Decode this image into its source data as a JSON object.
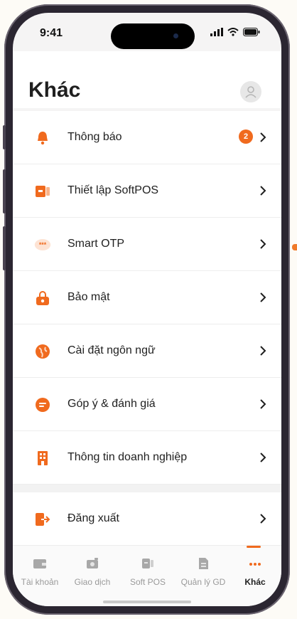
{
  "status_bar": {
    "time": "9:41"
  },
  "header": {
    "title": "Khác"
  },
  "menu": [
    {
      "label": "Thông báo",
      "icon": "bell-icon",
      "badge": "2"
    },
    {
      "label": "Thiết lập SoftPOS",
      "icon": "softpos-icon"
    },
    {
      "label": "Smart OTP",
      "icon": "otp-icon"
    },
    {
      "label": "Bảo mật",
      "icon": "lock-icon"
    },
    {
      "label": "Cài đặt ngôn ngữ",
      "icon": "globe-icon"
    },
    {
      "label": "Góp ý & đánh giá",
      "icon": "feedback-icon"
    },
    {
      "label": "Thông tin doanh nghiệp",
      "icon": "building-icon"
    },
    {
      "label": "Đăng xuất",
      "icon": "logout-icon"
    }
  ],
  "tab_bar": {
    "tabs": [
      {
        "label": "Tài khoản",
        "icon": "wallet-icon"
      },
      {
        "label": "Giao dịch",
        "icon": "transaction-icon"
      },
      {
        "label": "Soft POS",
        "icon": "pos-icon"
      },
      {
        "label": "Quản lý GD",
        "icon": "manage-icon"
      },
      {
        "label": "Khác",
        "icon": "more-icon",
        "active": true
      }
    ]
  },
  "colors": {
    "accent": "#f06a1e",
    "text": "#1f1f1f",
    "muted": "#9a9a9a"
  }
}
